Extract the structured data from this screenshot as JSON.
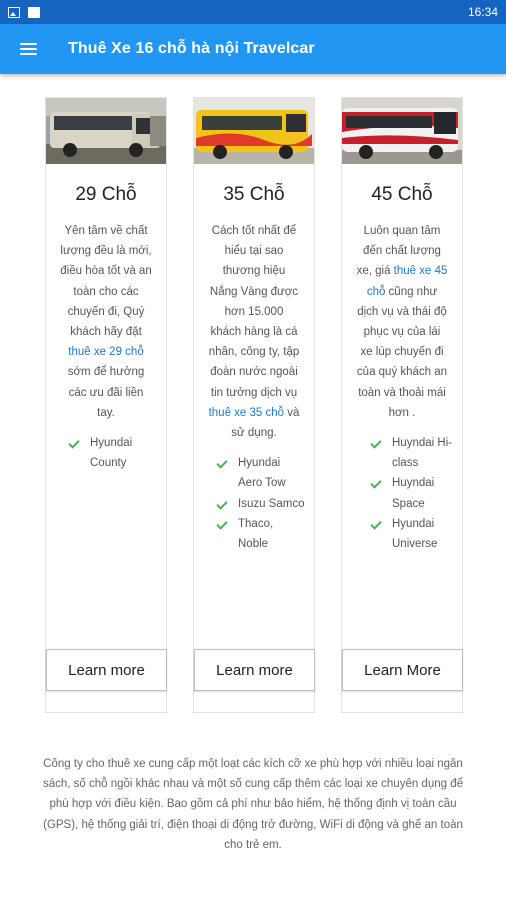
{
  "statusbar": {
    "time": "16:34",
    "icons": [
      "image-notification-icon",
      "download-notification-icon"
    ]
  },
  "appbar": {
    "title": "Thuê Xe 16 chỗ hà nội Travelcar",
    "menu_icon": "menu-icon"
  },
  "cards": [
    {
      "title": "29 Chỗ",
      "image": "minibus-photo",
      "desc_before": "Yên tâm về chất lượng đều là mới, điều hòa tốt và an toàn cho các chuyến đi, Quý khách hãy đặt ",
      "desc_link": "thuê xe 29 chỗ",
      "desc_after": " sớm để hưởng các ưu đãi liền tay.",
      "features": [
        "Hyundai County"
      ],
      "button": "Learn more"
    },
    {
      "title": "35 Chỗ",
      "image": "yellow-bus-photo",
      "desc_before": "Cách tốt nhất để hiểu tại sao thương hiệu Nắng Vàng được hơn 15.000 khách hàng là cá nhân, công ty, tập đoàn nước ngoài tin tưởng dịch vụ ",
      "desc_link": "thuê xe 35 chỗ",
      "desc_after": " và sử dụng.",
      "features": [
        "Hyundai Aero Tow",
        "Isuzu Samco",
        "Thaco, Noble"
      ],
      "button": "Learn more"
    },
    {
      "title": "45 Chỗ",
      "image": "red-coach-photo",
      "desc_before": "Luôn quan tâm đến chất lượng xe, giá ",
      "desc_link": "thuê xe 45 chỗ",
      "desc_after": " cũng như dịch vụ và thái độ phục vụ của lái xe lúp chuyến đi của quý khách an toàn và thoải mái hơn .",
      "features": [
        "Huyndai Hi-class",
        "Huyndai Space",
        "Hyundai Universe"
      ],
      "button": "Learn More"
    }
  ],
  "footer": "Công ty cho thuê xe cung cấp một loạt các kích cỡ xe phù hợp với nhiều loại ngân sách, số chỗ ngồi khác nhau và một số cung cấp thêm các loại xe chuyên dụng để phù hợp với điều kiện. Bao gồm cả phí như bảo hiểm, hệ thống định vị toàn cầu (GPS), hệ thống giải trí, điện thoại di động trở đường, WiFi di động và ghế an toàn cho trẻ em.",
  "colors": {
    "statusbar": "#1565c0",
    "appbar": "#2196f3",
    "link": "#1e78c8",
    "check": "#4caf50"
  }
}
